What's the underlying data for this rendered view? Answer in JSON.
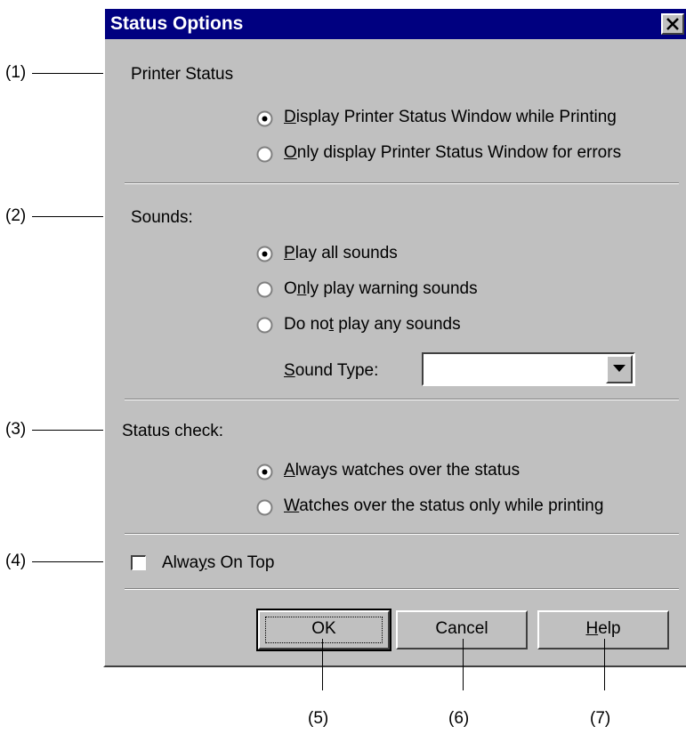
{
  "dialog": {
    "title": "Status Options"
  },
  "printer_status": {
    "heading": "Printer Status",
    "options": [
      {
        "pre": "",
        "key": "D",
        "post": "isplay Printer Status Window while Printing",
        "selected": true
      },
      {
        "pre": "",
        "key": "O",
        "post": "nly display Printer Status Window for errors",
        "selected": false
      }
    ]
  },
  "sounds": {
    "heading": "Sounds:",
    "options": [
      {
        "pre": "",
        "key": "P",
        "post": "lay all sounds",
        "selected": true
      },
      {
        "pre": "O",
        "key": "n",
        "post": "ly play warning sounds",
        "selected": false
      },
      {
        "pre": "Do no",
        "key": "t",
        "post": " play any sounds",
        "selected": false
      }
    ],
    "sound_type": {
      "pre": "",
      "key": "S",
      "post": "ound Type:"
    },
    "sound_type_value": ""
  },
  "status_check": {
    "heading": "Status check:",
    "options": [
      {
        "pre": "",
        "key": "A",
        "post": "lways watches over the status",
        "selected": true
      },
      {
        "pre": "",
        "key": "W",
        "post": "atches over the status only while printing",
        "selected": false
      }
    ]
  },
  "always_on_top": {
    "pre": "Alwa",
    "key": "y",
    "post": "s On Top",
    "checked": false
  },
  "buttons": {
    "ok": "OK",
    "cancel": "Cancel",
    "help_key": "H",
    "help_rest": "elp"
  },
  "callouts": [
    "(1)",
    "(2)",
    "(3)",
    "(4)",
    "(5)",
    "(6)",
    "(7)"
  ],
  "icons": {
    "close": "close-icon",
    "dropdown": "chevron-down-icon"
  },
  "colors": {
    "titlebar": "#000080",
    "face": "#c0c0c0"
  }
}
